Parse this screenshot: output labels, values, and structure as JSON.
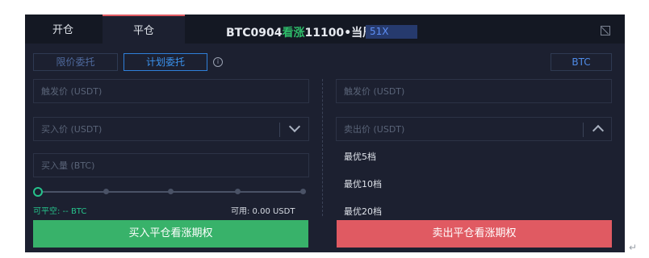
{
  "tabs": {
    "open": "开仓",
    "close": "平仓"
  },
  "contract": {
    "prefix": "BTC0904",
    "direction": "看涨",
    "strike": "11100",
    "suffix": "•当周",
    "leverage": "51X"
  },
  "order_type": {
    "limit": "限价委托",
    "plan": "计划委托",
    "coin": "BTC"
  },
  "fields": {
    "trigger_left": "触发价 (USDT)",
    "trigger_right": "触发价 (USDT)",
    "buy_price": "买入价 (USDT)",
    "sell_price": "卖出价 (USDT)",
    "buy_amount": "买入量 (BTC)"
  },
  "slider": {
    "value": 0
  },
  "available": {
    "closable": "可平空: -- BTC",
    "balance": "可用: 0.00 USDT"
  },
  "sell_price_options": [
    "最优5档",
    "最优10档",
    "最优20档"
  ],
  "actions": {
    "buy": "买入平仓看涨期权",
    "sell": "卖出平仓看涨期权"
  },
  "colors": {
    "buy": "#38b26a",
    "sell": "#e05a62",
    "accent": "#3b93ef",
    "bg": "#1c2030"
  }
}
